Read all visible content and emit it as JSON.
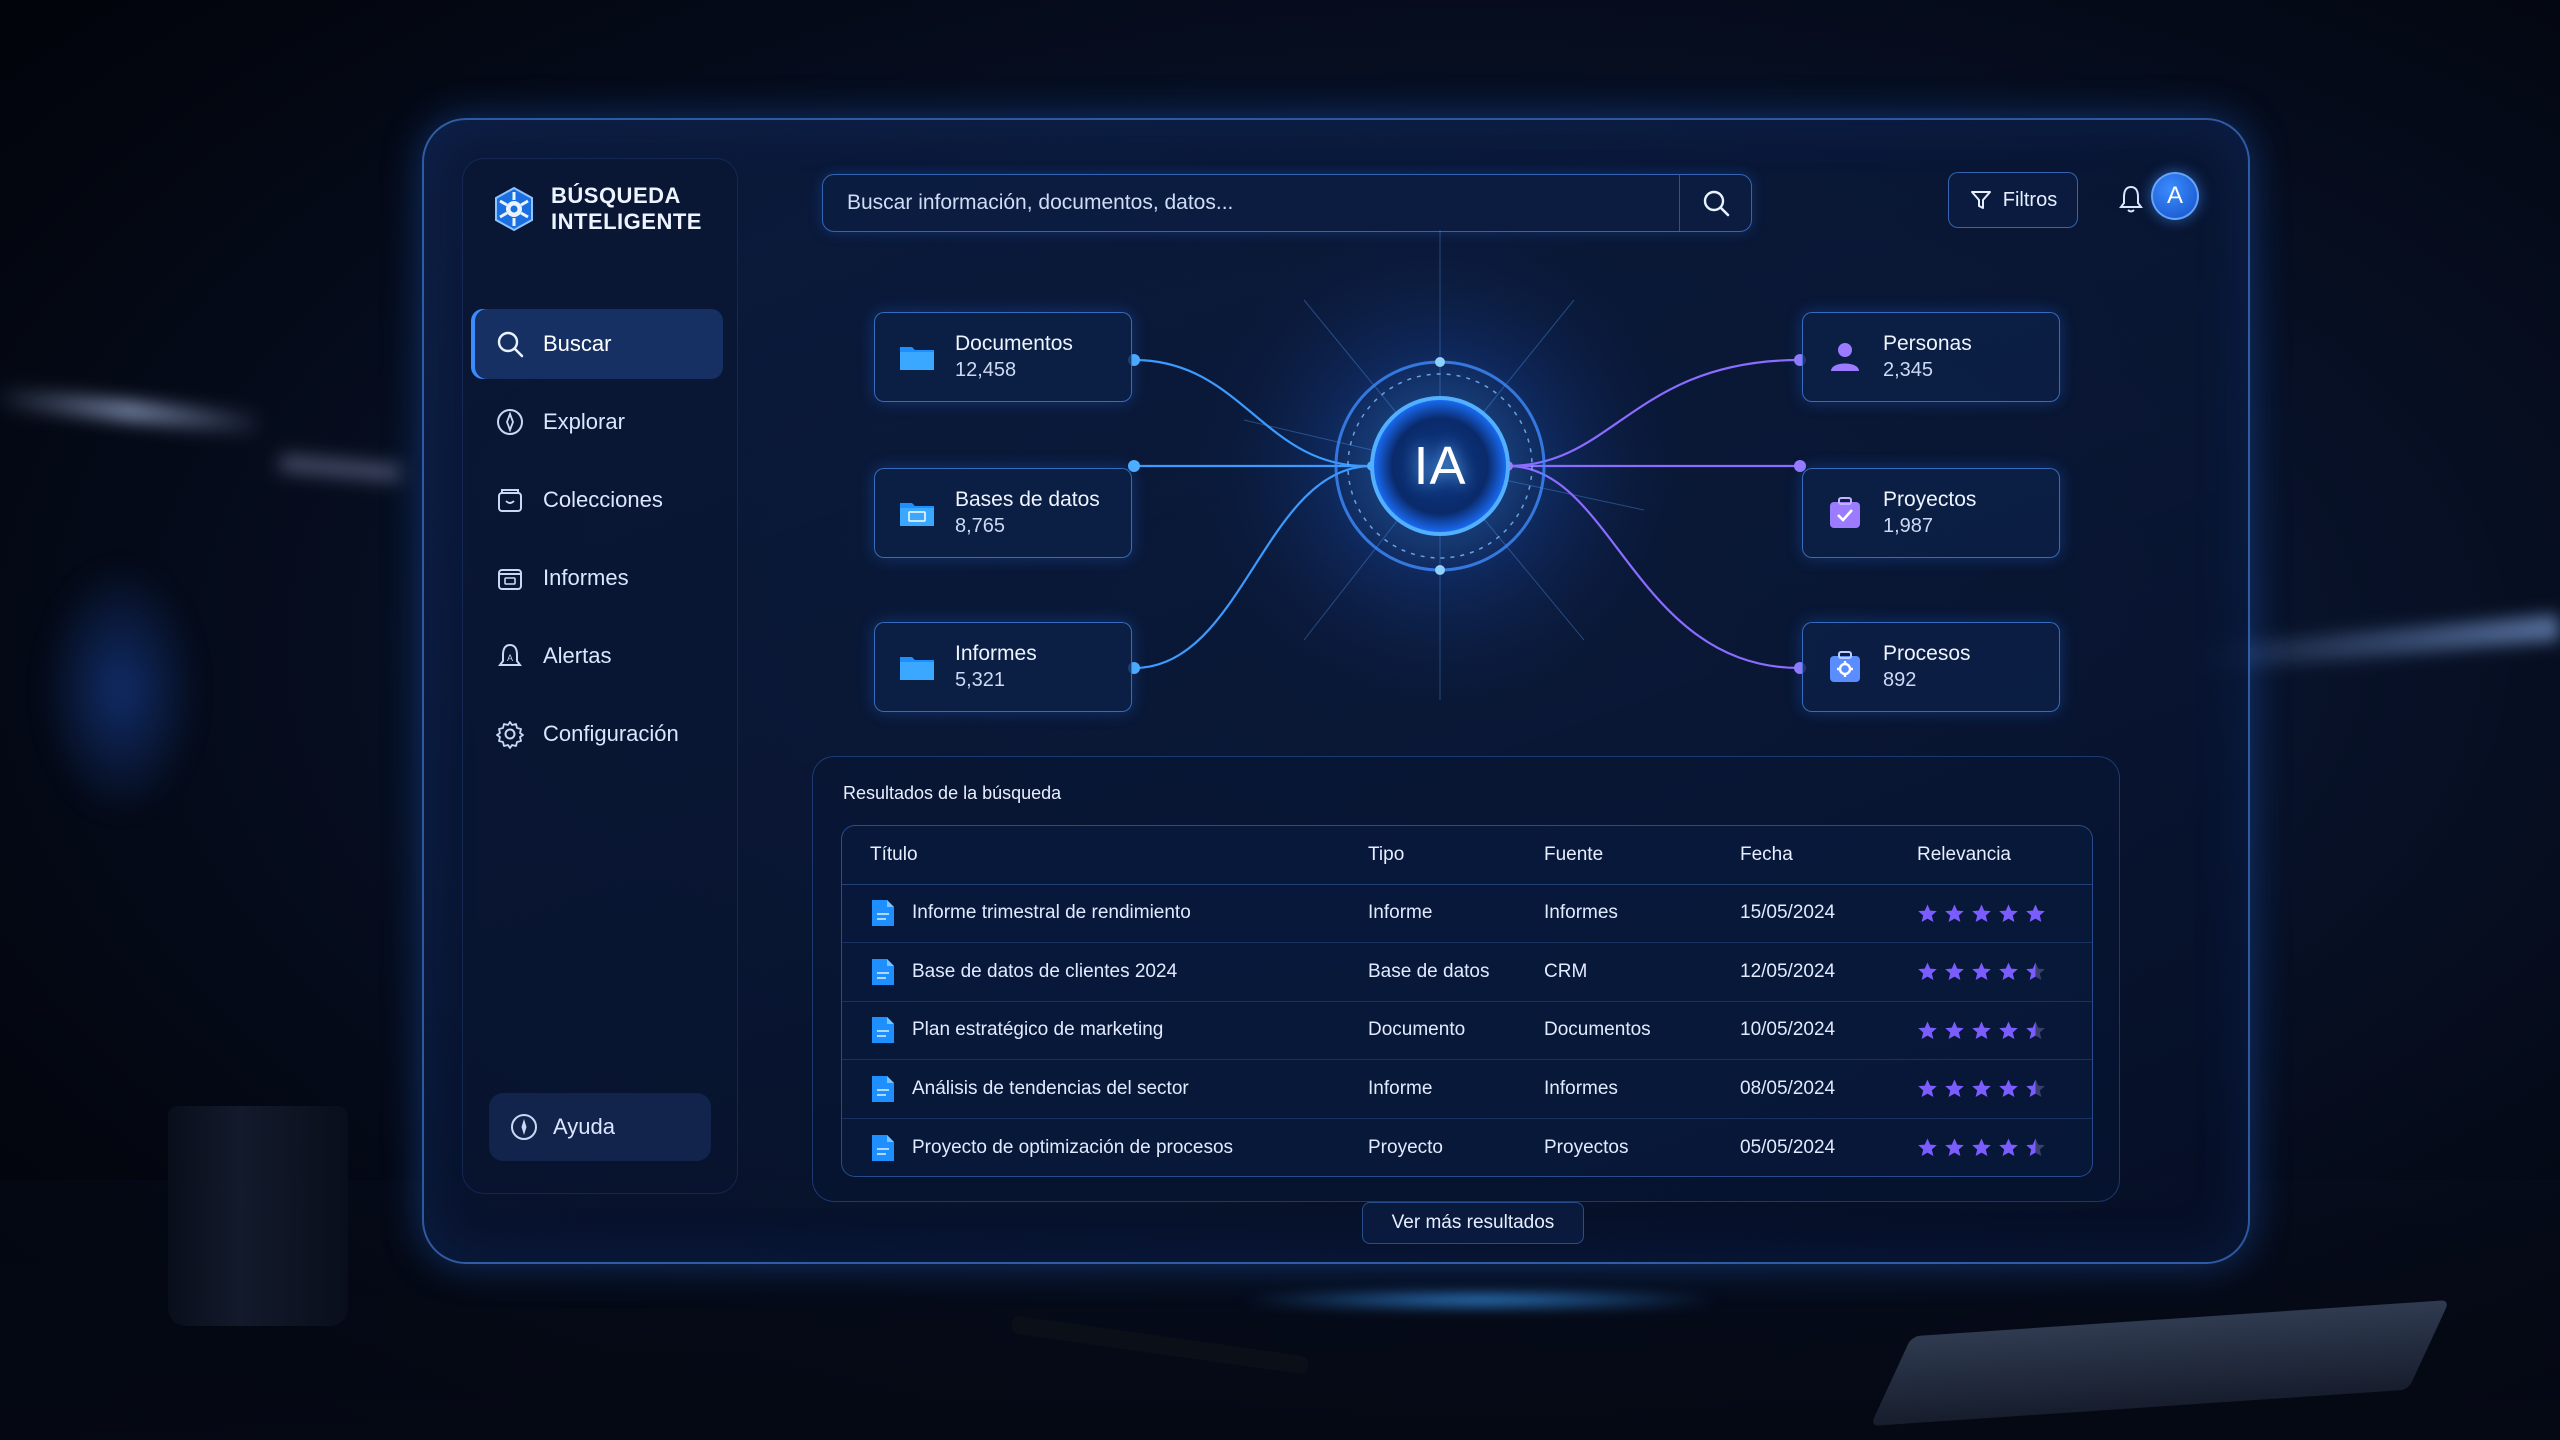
{
  "brand": {
    "line1": "BÚSQUEDA",
    "line2": "INTELIGENTE"
  },
  "sidebar": {
    "items": [
      {
        "label": "Buscar",
        "icon": "search-icon",
        "active": true
      },
      {
        "label": "Explorar",
        "icon": "compass-icon",
        "active": false
      },
      {
        "label": "Colecciones",
        "icon": "collection-icon",
        "active": false
      },
      {
        "label": "Informes",
        "icon": "report-icon",
        "active": false
      },
      {
        "label": "Alertas",
        "icon": "alert-icon",
        "active": false
      },
      {
        "label": "Configuración",
        "icon": "gear-icon",
        "active": false
      }
    ],
    "help_label": "Ayuda"
  },
  "search": {
    "placeholder": "Buscar información, documentos, datos..."
  },
  "header": {
    "filters_label": "Filtros",
    "avatar_initial": "A"
  },
  "hub": {
    "label": "IA"
  },
  "sources": [
    {
      "label": "Documentos",
      "count": "12,458",
      "icon": "folder-icon"
    },
    {
      "label": "Bases de datos",
      "count": "8,765",
      "icon": "database-folder-icon"
    },
    {
      "label": "Informes",
      "count": "5,321",
      "icon": "folder-icon"
    },
    {
      "label": "Personas",
      "count": "2,345",
      "icon": "person-icon"
    },
    {
      "label": "Proyectos",
      "count": "1,987",
      "icon": "project-icon"
    },
    {
      "label": "Procesos",
      "count": "892",
      "icon": "process-icon"
    }
  ],
  "results": {
    "title": "Resultados de la búsqueda",
    "columns": [
      "Título",
      "Tipo",
      "Fuente",
      "Fecha",
      "Relevancia"
    ],
    "rows": [
      {
        "title": "Informe trimestral de rendimiento",
        "type": "Informe",
        "source": "Informes",
        "date": "15/05/2024",
        "rating": 5
      },
      {
        "title": "Base de datos de clientes 2024",
        "type": "Base de datos",
        "source": "CRM",
        "date": "12/05/2024",
        "rating": 4.5
      },
      {
        "title": "Plan estratégico de marketing",
        "type": "Documento",
        "source": "Documentos",
        "date": "10/05/2024",
        "rating": 4.5
      },
      {
        "title": "Análisis de tendencias del sector",
        "type": "Informe",
        "source": "Informes",
        "date": "08/05/2024",
        "rating": 4.5
      },
      {
        "title": "Proyecto de optimización de procesos",
        "type": "Proyecto",
        "source": "Proyectos",
        "date": "05/05/2024",
        "rating": 4.5
      }
    ],
    "more_label": "Ver más resultados"
  },
  "colors": {
    "accent": "#3a8cff",
    "star": "#7b5cff",
    "panel_border": "#4f96ff"
  }
}
